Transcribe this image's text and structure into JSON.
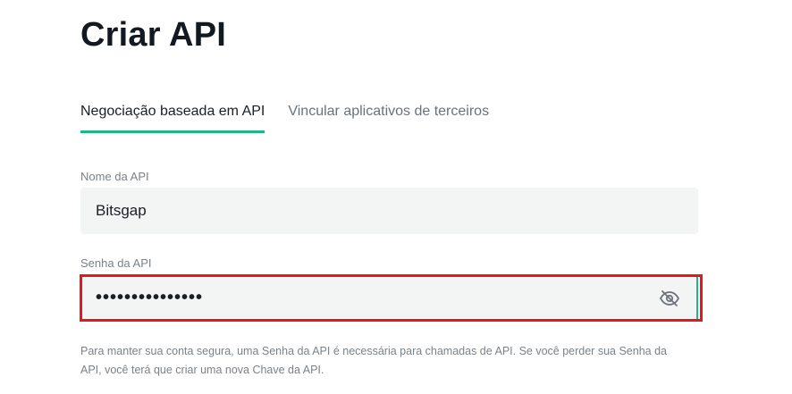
{
  "page": {
    "title": "Criar API"
  },
  "tabs": [
    {
      "label": "Negociação baseada em API",
      "active": true
    },
    {
      "label": "Vincular aplicativos de terceiros",
      "active": false
    }
  ],
  "form": {
    "name_label": "Nome da API",
    "name_value": "Bitsgap",
    "password_label": "Senha da API",
    "password_value": "•••••••••••••••",
    "visibility_icon": "eye-off-icon",
    "help_text": "Para manter sua conta segura, uma Senha da API é necessária para chamadas de API. Se você perder sua Senha da API, você terá que criar uma nova Chave da API."
  },
  "colors": {
    "accent": "#1fb58a",
    "highlight": "#e8161b",
    "input_bg": "#f3f4f4"
  }
}
